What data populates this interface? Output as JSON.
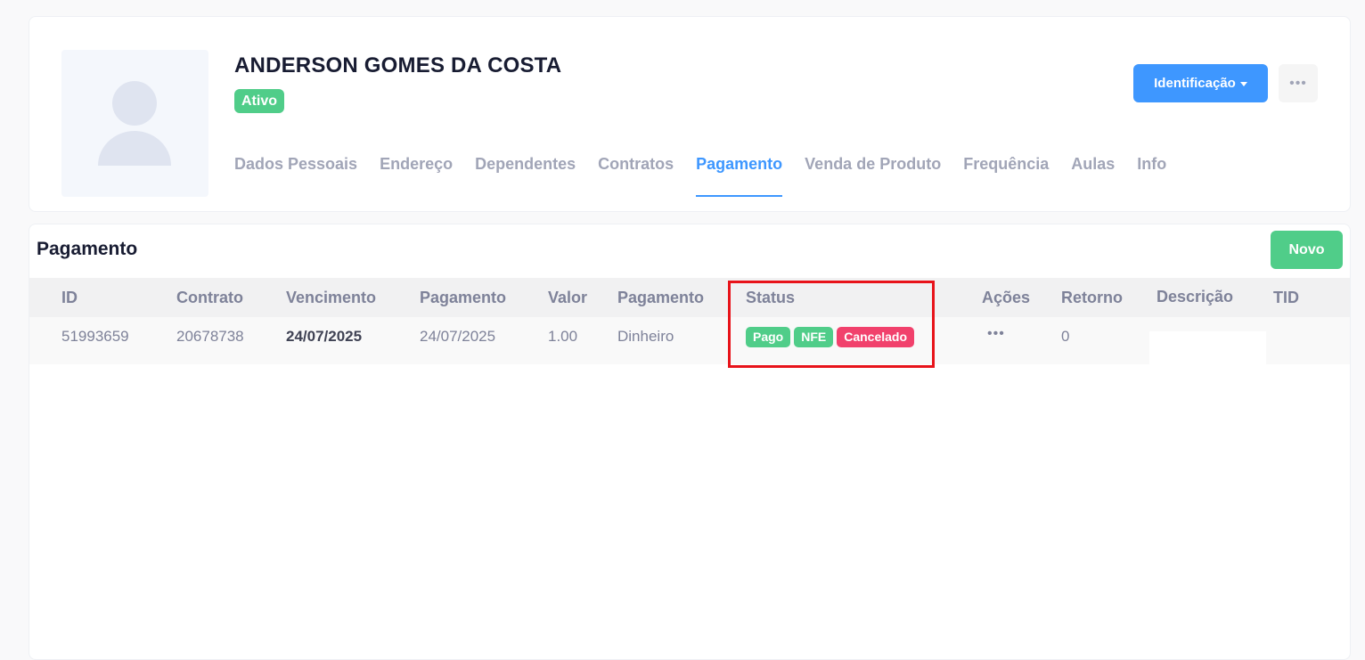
{
  "profile": {
    "name": "ANDERSON GOMES DA COSTA",
    "status": "Ativo",
    "identification_button": "Identificação",
    "more_button": "•••",
    "avatar_icon": "user-placeholder-icon",
    "tabs": [
      {
        "label": "Dados Pessoais",
        "active": false
      },
      {
        "label": "Endereço",
        "active": false
      },
      {
        "label": "Dependentes",
        "active": false
      },
      {
        "label": "Contratos",
        "active": false
      },
      {
        "label": "Pagamento",
        "active": true
      },
      {
        "label": "Venda de Produto",
        "active": false
      },
      {
        "label": "Frequência",
        "active": false
      },
      {
        "label": "Aulas",
        "active": false
      },
      {
        "label": "Info",
        "active": false
      }
    ]
  },
  "payments": {
    "title": "Pagamento",
    "new_button": "Novo",
    "columns": [
      "ID",
      "Contrato",
      "Vencimento",
      "Pagamento",
      "Valor",
      "Pagamento",
      "Status",
      "Ações",
      "Retorno",
      "Descrição",
      "TID"
    ],
    "rows": [
      {
        "id": "51993659",
        "contrato": "20678738",
        "vencimento": "24/07/2025",
        "pagamento_data": "24/07/2025",
        "valor": "1.00",
        "pagamento_forma": "Dinheiro",
        "status_badges": [
          "Pago",
          "NFE",
          "Cancelado"
        ],
        "acoes": "•••",
        "retorno": "0",
        "descricao": "",
        "tid": ""
      }
    ]
  },
  "colors": {
    "primary": "#3e97ff",
    "success": "#50cd89",
    "danger": "#f1416c",
    "highlight": "#e8131a"
  }
}
